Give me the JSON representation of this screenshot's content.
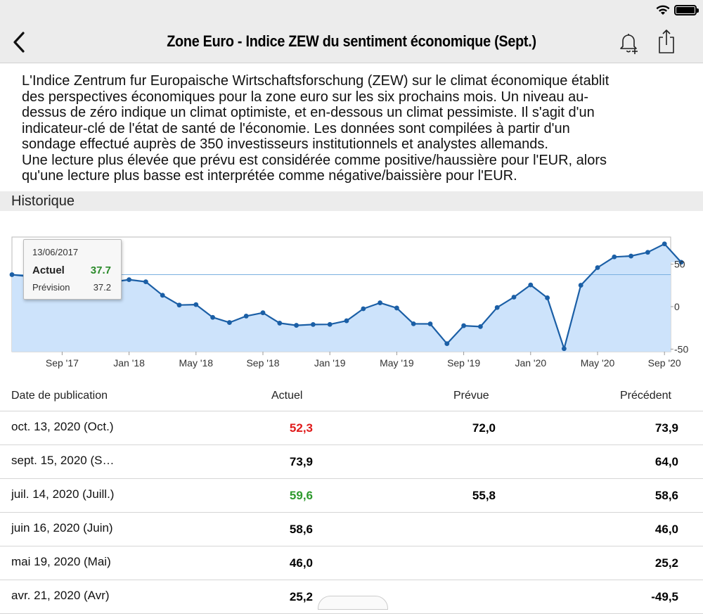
{
  "header": {
    "title": "Zone Euro - Indice ZEW du sentiment économique (Sept.)",
    "back_icon": "chevron-left-icon",
    "alert_icon": "bell-plus-icon",
    "share_icon": "share-icon"
  },
  "description": [
    "L'Indice Zentrum fur Europaische Wirtschaftsforschung (ZEW) sur le climat économique établit",
    "des perspectives économiques pour la zone euro sur les six prochains mois. Un niveau au-",
    "dessus de zéro indique un climat optimiste, et en-dessous un climat pessimiste. Il s'agit d'un",
    "indicateur-clé de l'état de santé de l'économie. Les données sont compilées à partir d'un",
    "sondage effectué auprès de 350 investisseurs institutionnels et analystes allemands.",
    "Une lecture plus élevée que prévu est considérée comme positive/haussière pour l'EUR, alors",
    "qu'une lecture plus basse est interprétée comme négative/baissière pour l'EUR."
  ],
  "section_title": "Historique",
  "tooltip": {
    "date": "13/06/2017",
    "actual_label": "Actuel",
    "actual_value": "37.7",
    "forecast_label": "Prévision",
    "forecast_value": "37.2"
  },
  "chart_data": {
    "type": "area",
    "x": [
      "2017-06",
      "2017-07",
      "2017-08",
      "2017-09",
      "2017-10",
      "2017-11",
      "2017-12",
      "2018-01",
      "2018-02",
      "2018-03",
      "2018-04",
      "2018-05",
      "2018-06",
      "2018-07",
      "2018-08",
      "2018-09",
      "2018-10",
      "2018-11",
      "2018-12",
      "2019-01",
      "2019-02",
      "2019-03",
      "2019-04",
      "2019-05",
      "2019-06",
      "2019-07",
      "2019-08",
      "2019-09",
      "2019-10",
      "2019-11",
      "2019-12",
      "2020-01",
      "2020-02",
      "2020-03",
      "2020-04",
      "2020-05",
      "2020-06",
      "2020-07",
      "2020-08",
      "2020-09",
      "2020-10"
    ],
    "values": [
      37.7,
      35.6,
      29.3,
      26.7,
      26.7,
      30.9,
      29.0,
      31.8,
      29.3,
      13.4,
      1.9,
      2.4,
      -12.6,
      -18.7,
      -11.1,
      -7.2,
      -19.4,
      -22.0,
      -21.0,
      -20.9,
      -16.6,
      -2.5,
      4.5,
      -1.6,
      -20.2,
      -20.3,
      -43.6,
      -22.4,
      -23.5,
      -1.0,
      11.2,
      25.6,
      10.4,
      -49.5,
      25.2,
      46.0,
      58.6,
      59.6,
      64.0,
      73.9,
      52.3
    ],
    "xticks": [
      "Sep '17",
      "Jan '18",
      "May '18",
      "Sep '18",
      "Jan '19",
      "May '19",
      "Sep '19",
      "Jan '20",
      "May '20",
      "Sep '20"
    ],
    "yticks": [
      "50",
      "0",
      "-50"
    ],
    "ylim": [
      -53,
      82
    ],
    "reference_line": 37.7,
    "grid": false,
    "colors": {
      "line": "#1b5fa6",
      "area": "#cde3fb",
      "reference": "#7ab0e0"
    }
  },
  "table": {
    "headers": {
      "date": "Date de publication",
      "actual": "Actuel",
      "forecast": "Prévue",
      "previous": "Précédent"
    },
    "rows": [
      {
        "date": "oct. 13, 2020 (Oct.)",
        "actual": "52,3",
        "actual_status": "neg",
        "forecast": "72,0",
        "previous": "73,9"
      },
      {
        "date": "sept. 15, 2020 (S…",
        "actual": "73,9",
        "actual_status": "neu",
        "forecast": "",
        "previous": "64,0"
      },
      {
        "date": "juil. 14, 2020 (Juill.)",
        "actual": "59,6",
        "actual_status": "pos",
        "forecast": "55,8",
        "previous": "58,6"
      },
      {
        "date": "juin 16, 2020 (Juin)",
        "actual": "58,6",
        "actual_status": "neu",
        "forecast": "",
        "previous": "46,0"
      },
      {
        "date": "mai 19, 2020 (Mai)",
        "actual": "46,0",
        "actual_status": "neu",
        "forecast": "",
        "previous": "25,2"
      },
      {
        "date": "avr. 21, 2020 (Avr)",
        "actual": "25,2",
        "actual_status": "neu",
        "forecast": "",
        "previous": "-49,5"
      }
    ]
  }
}
